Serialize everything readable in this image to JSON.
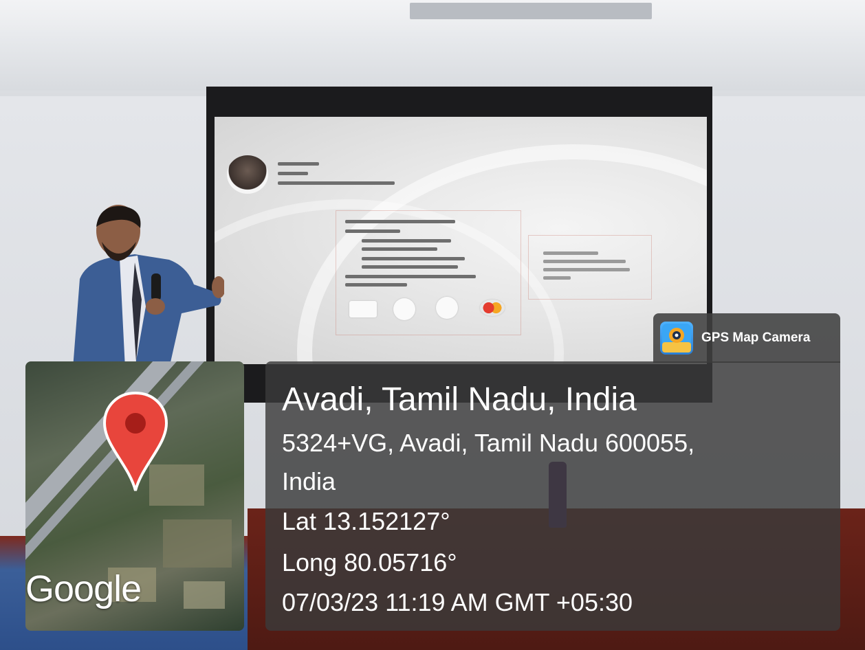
{
  "overlay": {
    "app_name": "GPS Map Camera",
    "place_title": "Avadi, Tamil Nadu, India",
    "address_line1": "5324+VG, Avadi, Tamil Nadu 600055,",
    "address_line2": "India",
    "latitude": "Lat 13.152127°",
    "longitude": "Long 80.05716°",
    "datetime": "07/03/23 11:19 AM GMT +05:30",
    "map_logo": "Google",
    "pin_color": "#e8453c",
    "icons": [
      "map-pin-icon",
      "gps-map-camera-icon"
    ]
  }
}
